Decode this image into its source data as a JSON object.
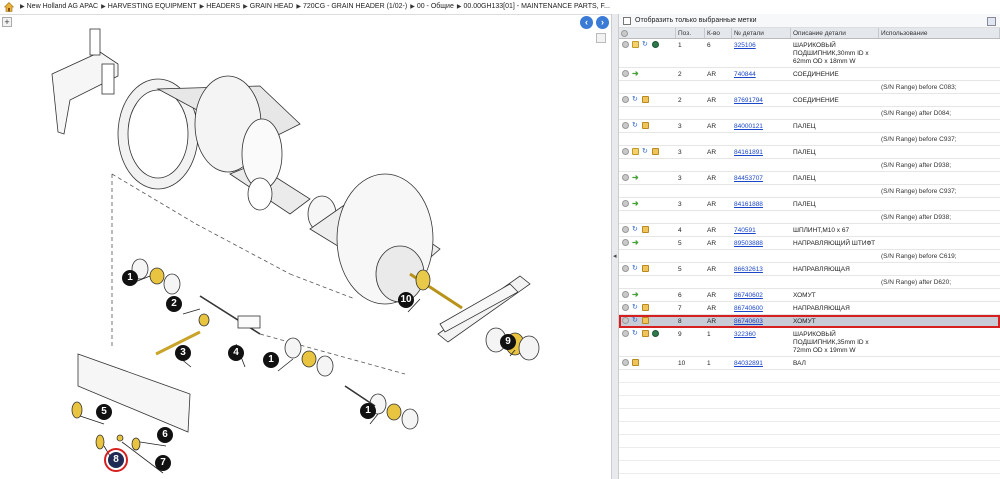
{
  "breadcrumb": {
    "items": [
      "New Holland AG APAC",
      "HARVESTING EQUIPMENT",
      "HEADERS",
      "GRAIN HEAD",
      "720CG - GRAIN HEADER (1/02-)",
      "00 - Общие",
      "00.00GH133[01] - MAINTENANCE PARTS, F..."
    ]
  },
  "diagram": {
    "callouts": [
      "1",
      "2",
      "3",
      "4",
      "1",
      "1",
      "5",
      "6",
      "7",
      "8",
      "9",
      "10"
    ]
  },
  "parts": {
    "filter_label": "Отобразить только выбранные метки",
    "columns": [
      "",
      "Поз.",
      "К-во",
      "№ детали",
      "Описание детали",
      "Использование"
    ],
    "rows": [
      {
        "pos": "1",
        "qty": "6",
        "part": "325106",
        "desc": "ШАРИКОВЫЙ ПОДШИПНИК,30mm ID x 62mm OD x 18mm W",
        "note": "",
        "icons": [
          "add",
          "doc",
          "flip",
          "globe"
        ]
      },
      {
        "pos": "2",
        "qty": "AR",
        "part": "740844",
        "desc": "СОЕДИНЕНИЕ",
        "note": "(S/N Range) before C083;",
        "icons": [
          "add",
          "arrow"
        ]
      },
      {
        "pos": "2",
        "qty": "AR",
        "part": "87691794",
        "desc": "СОЕДИНЕНИЕ",
        "note": "(S/N Range) after D084;",
        "icons": [
          "add",
          "flip",
          "box"
        ]
      },
      {
        "pos": "3",
        "qty": "AR",
        "part": "84000121",
        "desc": "ПАЛЕЦ",
        "note": "(S/N Range) before C937;",
        "icons": [
          "add",
          "flip",
          "box"
        ]
      },
      {
        "pos": "3",
        "qty": "AR",
        "part": "84161891",
        "desc": "ПАЛЕЦ",
        "note": "(S/N Range) after D938;",
        "icons": [
          "add",
          "doc",
          "flip",
          "box"
        ]
      },
      {
        "pos": "3",
        "qty": "AR",
        "part": "84453707",
        "desc": "ПАЛЕЦ",
        "note": "(S/N Range) before C937;",
        "icons": [
          "add",
          "arrow"
        ]
      },
      {
        "pos": "3",
        "qty": "AR",
        "part": "84161888",
        "desc": "ПАЛЕЦ",
        "note": "(S/N Range) after D938;",
        "icons": [
          "add",
          "arrow"
        ]
      },
      {
        "pos": "4",
        "qty": "AR",
        "part": "740591",
        "desc": "ШПЛИНТ,M10 x 67",
        "note": "",
        "icons": [
          "add",
          "flip",
          "box"
        ]
      },
      {
        "pos": "5",
        "qty": "AR",
        "part": "89503888",
        "desc": "НАПРАВЛЯЮЩИЙ ШТИФТ",
        "note": "(S/N Range) before C619;",
        "icons": [
          "add",
          "arrow"
        ]
      },
      {
        "pos": "5",
        "qty": "AR",
        "part": "86632613",
        "desc": "НАПРАВЛЯЮЩАЯ",
        "note": "(S/N Range) after D620;",
        "icons": [
          "add",
          "flip",
          "box"
        ]
      },
      {
        "pos": "6",
        "qty": "AR",
        "part": "86740602",
        "desc": "ХОМУТ",
        "note": "",
        "icons": [
          "add",
          "arrow"
        ]
      },
      {
        "pos": "7",
        "qty": "AR",
        "part": "86740600",
        "desc": "НАПРАВЛЯЮЩАЯ",
        "note": "",
        "icons": [
          "add",
          "flip",
          "box"
        ]
      },
      {
        "pos": "8",
        "qty": "AR",
        "part": "86740603",
        "desc": "ХОМУТ",
        "note": "",
        "icons": [
          "add",
          "flip",
          "box"
        ],
        "selected": true
      },
      {
        "pos": "9",
        "qty": "1",
        "part": "322360",
        "desc": "ШАРИКОВЫЙ ПОДШИПНИК,35mm ID x 72mm OD x 19mm W",
        "note": "",
        "icons": [
          "add",
          "flip",
          "box",
          "globe"
        ]
      },
      {
        "pos": "10",
        "qty": "1",
        "part": "84032891",
        "desc": "ВАЛ",
        "note": "",
        "icons": [
          "add",
          "box"
        ]
      }
    ]
  }
}
